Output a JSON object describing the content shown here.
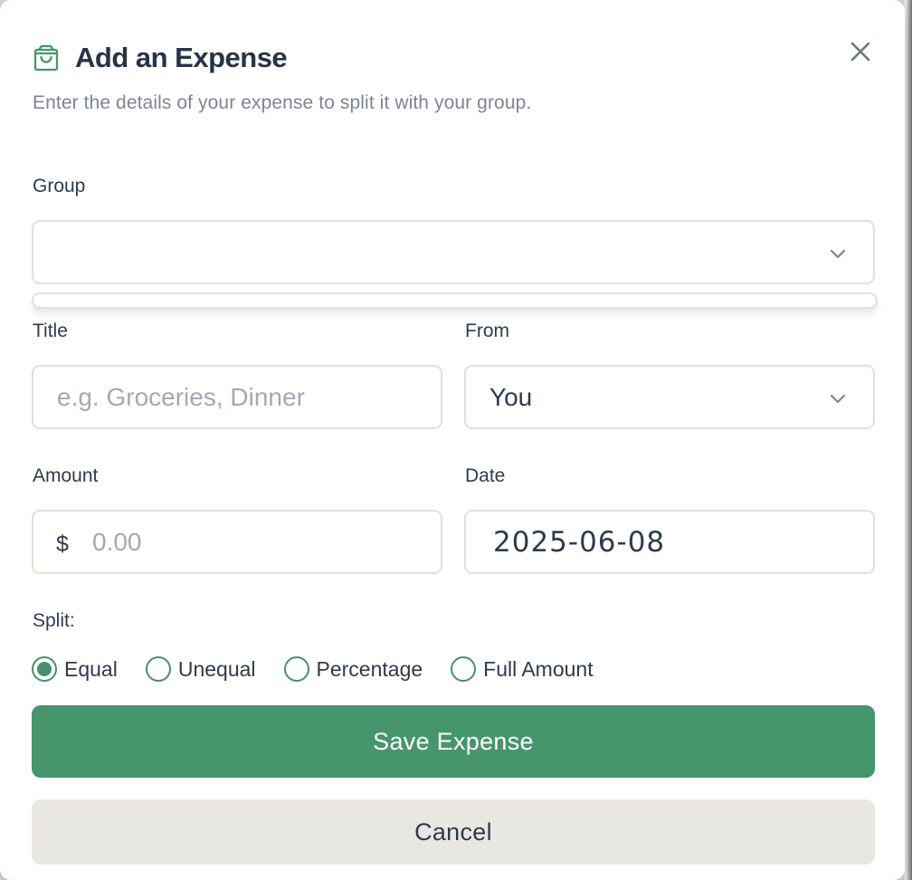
{
  "dialog": {
    "title": "Add an Expense",
    "subtitle": "Enter the details of your expense to split it with your group.",
    "title_icon": "shopping-bag-icon",
    "close_icon": "close-icon"
  },
  "form": {
    "group": {
      "label": "Group",
      "value": "",
      "icon": "chevron-down-icon"
    },
    "title": {
      "label": "Title",
      "value": "",
      "placeholder": "e.g. Groceries, Dinner"
    },
    "from": {
      "label": "From",
      "value": "You",
      "icon": "chevron-down-icon"
    },
    "amount": {
      "label": "Amount",
      "currency_symbol": "$",
      "value": "",
      "placeholder": "0.00"
    },
    "date": {
      "label": "Date",
      "value": "2025-06-08"
    },
    "split": {
      "label": "Split:",
      "selected": "Equal",
      "options": [
        "Equal",
        "Unequal",
        "Percentage",
        "Full Amount"
      ]
    }
  },
  "actions": {
    "save_label": "Save Expense",
    "cancel_label": "Cancel"
  },
  "colors": {
    "accent": "#47956d",
    "radio_accent": "#47906c",
    "text": "#2f3a4d",
    "muted_text": "#7c8596",
    "field_border": "#e0e2d6",
    "cancel_background": "#e9e7e1"
  }
}
